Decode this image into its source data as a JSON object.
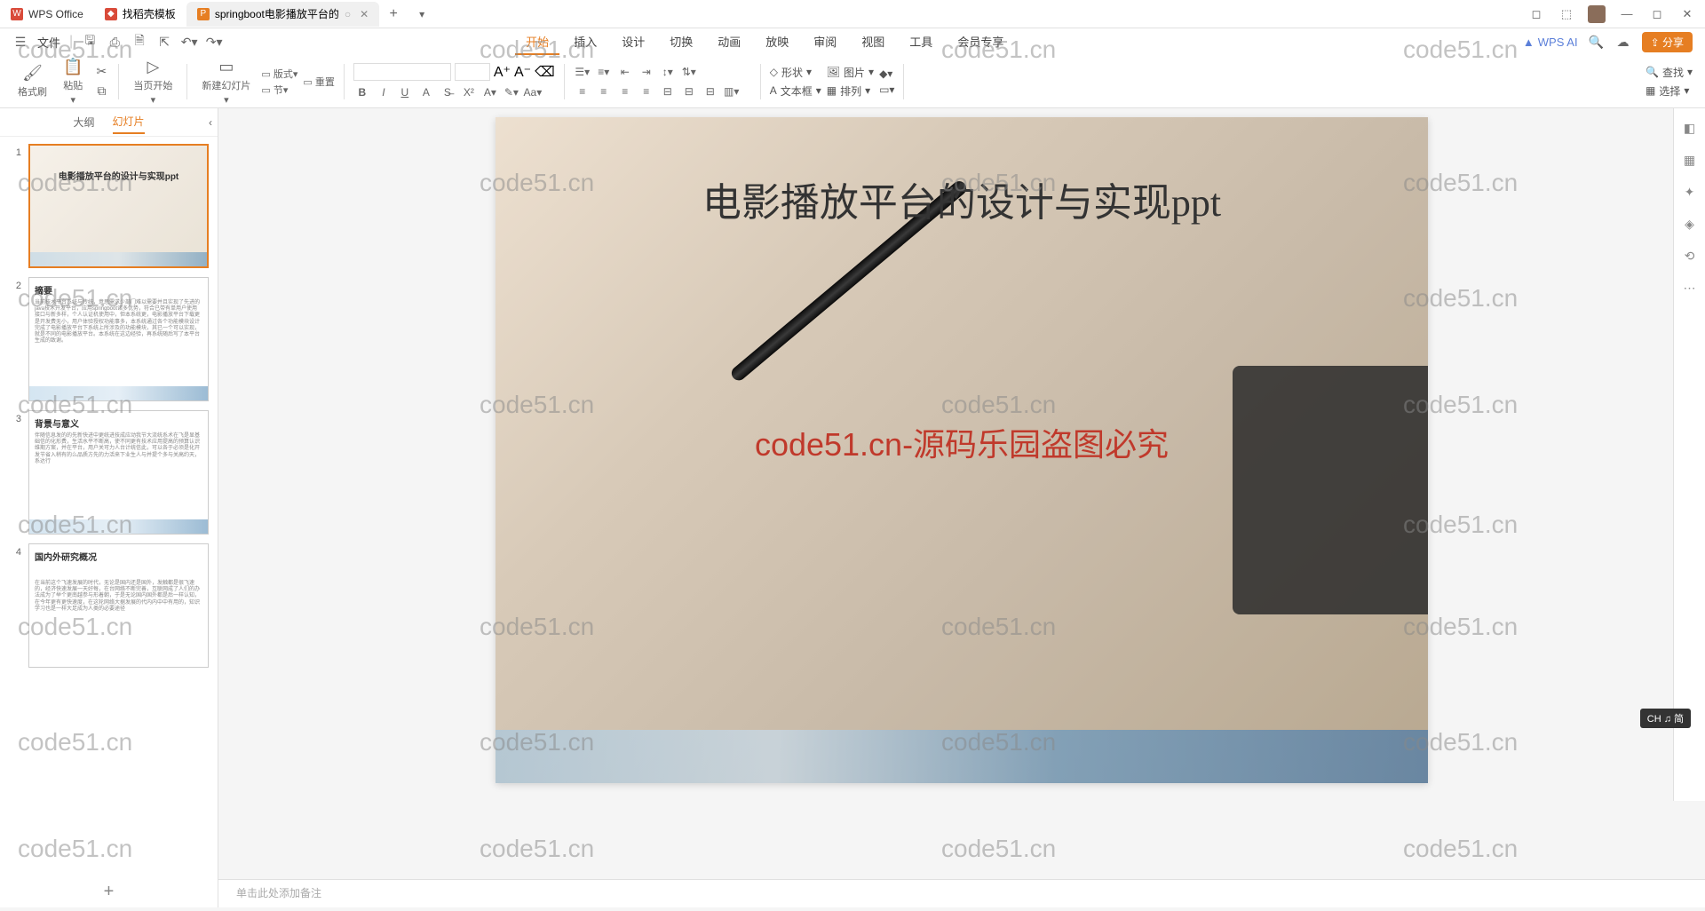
{
  "app": {
    "name": "WPS Office"
  },
  "tabs": [
    {
      "label": "找稻壳模板"
    },
    {
      "label": "springboot电影播放平台的",
      "active": true
    }
  ],
  "file_menu": "文件",
  "menu_tabs": {
    "start": "开始",
    "insert": "插入",
    "design": "设计",
    "transition": "切换",
    "animation": "动画",
    "slideshow": "放映",
    "review": "审阅",
    "view": "视图",
    "tools": "工具",
    "member": "会员专享"
  },
  "wps_ai": "WPS AI",
  "share": "分享",
  "ribbon": {
    "format_painter": "格式刷",
    "paste": "粘贴",
    "current_page": "当页开始",
    "new_slide": "新建幻灯片",
    "layout": "版式",
    "section": "节",
    "reset": "重置",
    "shape": "形状",
    "image": "图片",
    "textbox": "文本框",
    "arrange": "排列",
    "find": "查找",
    "select": "选择"
  },
  "sidebar": {
    "outline": "大纲",
    "slides": "幻灯片"
  },
  "thumbs": [
    {
      "num": "1",
      "title": "电影播放平台的设计与实现ppt"
    },
    {
      "num": "2",
      "title": "摘要"
    },
    {
      "num": "3",
      "title": "背景与意义"
    },
    {
      "num": "4",
      "title": "国内外研究概况"
    }
  ],
  "slide": {
    "title": "电影播放平台的设计与实现ppt",
    "watermark": "code51.cn-源码乐园盗图必究"
  },
  "notes_placeholder": "单击此处添加备注",
  "ime": "CH ♫ 简",
  "page_watermark": "code51.cn"
}
